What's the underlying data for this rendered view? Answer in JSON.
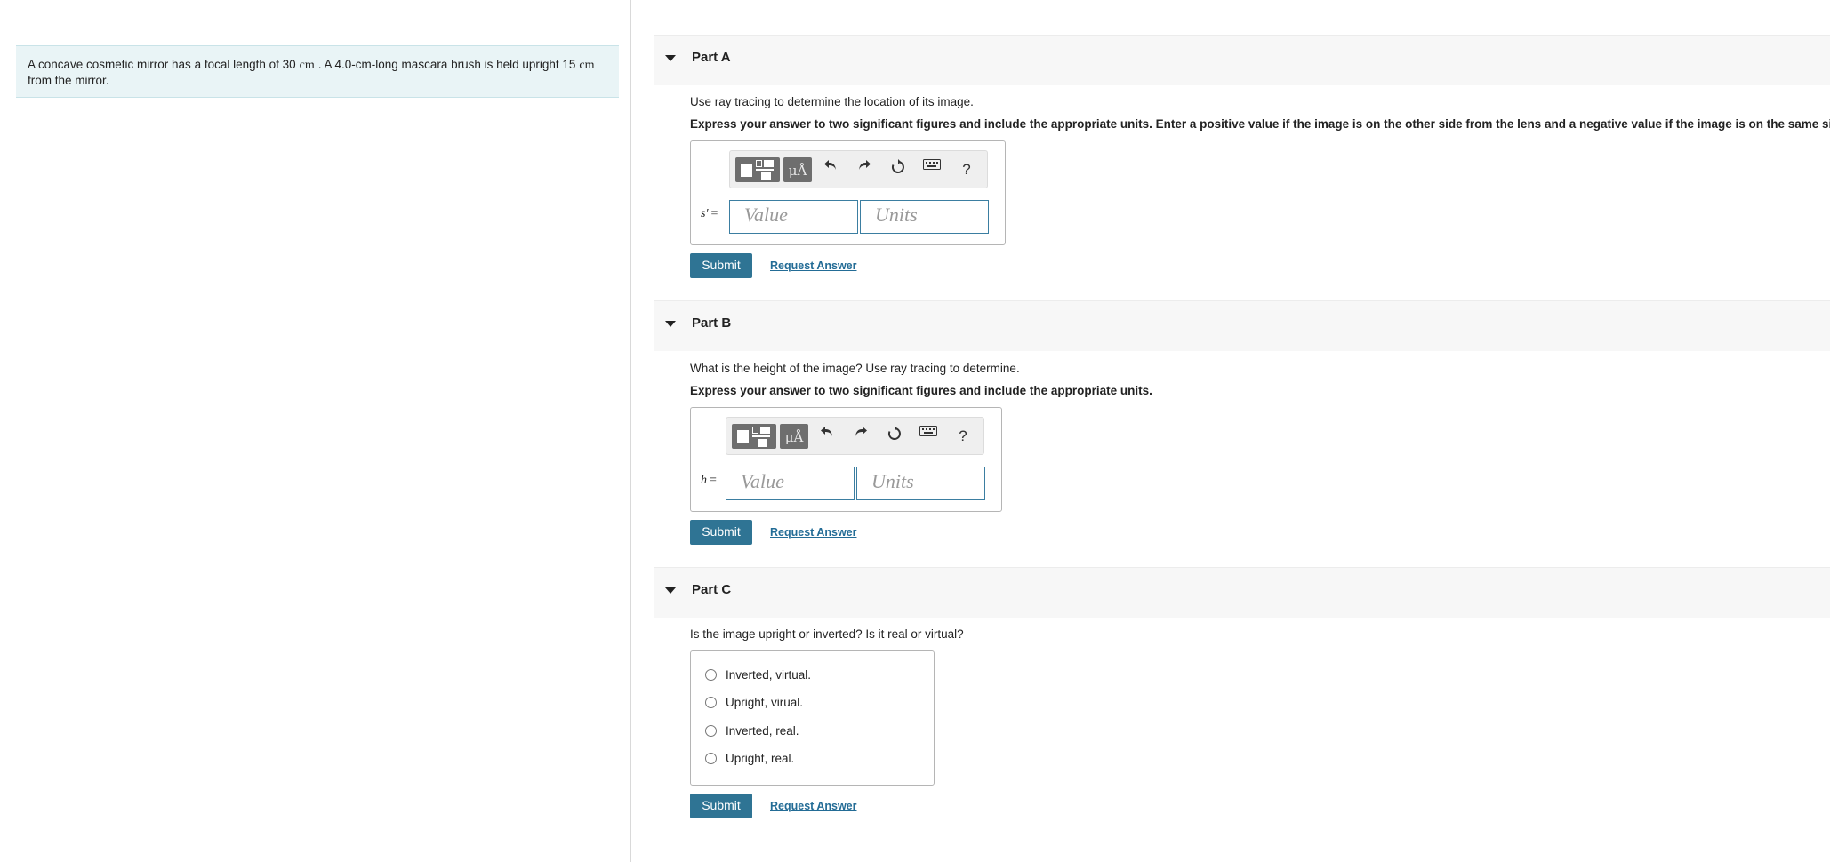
{
  "problem": {
    "text_part1": "A concave cosmetic mirror has a focal length of 30",
    "unit1": "cm",
    "text_part2": ". A 4.0-cm-long mascara brush is held upright 15",
    "unit2": "cm",
    "text_part3": "from the mirror."
  },
  "toolbar": {
    "units_label": "μÅ",
    "help_label": "?"
  },
  "parts": [
    {
      "title": "Part A",
      "prompt": "Use ray tracing to determine the location of its image.",
      "instruction": "Express your answer to two significant figures and include the appropriate units. Enter a positive value if the image is on the other side from the lens and a negative value if the image is on the same side.",
      "variable": "s′",
      "value_placeholder": "Value",
      "units_placeholder": "Units",
      "submit_label": "Submit",
      "request_label": "Request Answer"
    },
    {
      "title": "Part B",
      "prompt": "What is the height of the image? Use ray tracing to determine.",
      "instruction": "Express your answer to two significant figures and include the appropriate units.",
      "variable": "h",
      "value_placeholder": "Value",
      "units_placeholder": "Units",
      "submit_label": "Submit",
      "request_label": "Request Answer"
    },
    {
      "title": "Part C",
      "prompt": "Is the image upright or inverted? Is it real or virtual?",
      "options": [
        "Inverted, virtual.",
        "Upright, virual.",
        "Inverted, real.",
        "Upright, real."
      ],
      "submit_label": "Submit",
      "request_label": "Request Answer"
    }
  ]
}
